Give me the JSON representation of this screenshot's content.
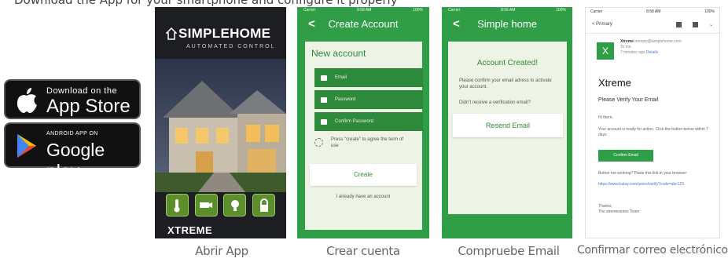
{
  "top_text": "Download the App for your smartphone and configure it properly",
  "badges": {
    "apple_small": "Download on the",
    "apple_big": "App Store",
    "google_small": "ANDROID APP ON",
    "google_big": "Google play"
  },
  "phone1": {
    "brand": "SIMPLEHOME",
    "brand_sub": "AUTOMATED CONTROL",
    "footer_brand": "XTREME",
    "icons": [
      "thermometer-icon",
      "camera-icon",
      "bulb-icon",
      "lock-icon"
    ]
  },
  "phone2": {
    "carrier": "Carrier",
    "time": "8:58 AM",
    "battery": "100%",
    "title": "Create Account",
    "card_title": "New account",
    "fields": [
      "Email",
      "Password",
      "Confirm Password"
    ],
    "agree_text": "Press \"create\" to agree the term of use",
    "create_label": "Create",
    "already_label": "I already have an account"
  },
  "phone3": {
    "carrier": "Carrier",
    "time": "8:56 AM",
    "battery": "100%",
    "title": "Simple home",
    "card_title": "Account Created!",
    "text1": "Please confirm your email adress to activate your account.",
    "text2": "Didn't receive a verification email?",
    "resend_label": "Resend Email"
  },
  "phone4": {
    "carrier": "Carrier",
    "time": "8:58 AM",
    "battery": "100%",
    "back_label": "Primary",
    "avatar": "X",
    "sender": "Xtreme",
    "sender_email": "noreply@simplehome.com",
    "to": "To me",
    "time_ago": "7 minutes ago",
    "details": "Details",
    "brand": "Xtreme",
    "subject": "Please Verify Your Email",
    "greeting": "Hi there,",
    "body1": "Your account is ready for action. Click the button below within 7 days.",
    "confirm_label": "Confirm Email",
    "body2": "Button not working? Paste this link in your browser:",
    "link": "https://www.kalay.com/users/verify?code=abc123",
    "thanks": "Thanks,",
    "team": "The xtremeseries Team"
  },
  "captions": [
    "Abrir App",
    "Crear cuenta",
    "Compruebe Email",
    "Confirmar correo electrónico"
  ]
}
